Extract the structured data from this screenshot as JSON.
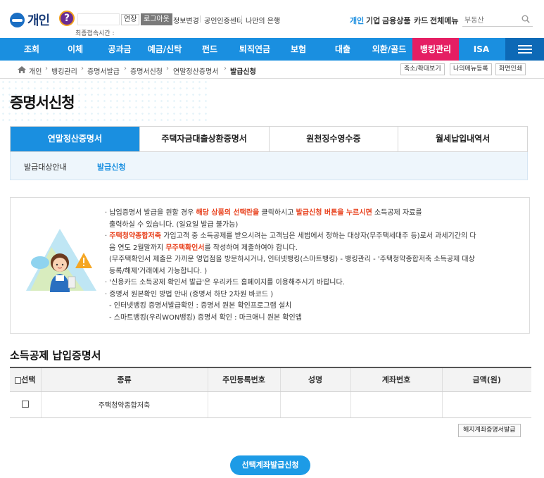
{
  "header": {
    "brand": "개인",
    "help_glyph": "?",
    "extend_label": "연장",
    "logout_label": "로그아웃",
    "top_links": [
      "정보변경",
      "공인인증센터",
      "나만의 은행"
    ],
    "last_login_label": "최종접속시간 :",
    "right_links": [
      {
        "label": "개인",
        "active": true
      },
      {
        "label": "기업",
        "active": false
      },
      {
        "label": "금융상품",
        "active": false
      },
      {
        "label": "카드",
        "active": false
      },
      {
        "label": "전체메뉴",
        "active": false
      }
    ],
    "search": {
      "value": "부동산",
      "icon": "search-icon"
    }
  },
  "nav": {
    "items": [
      {
        "label": "조회",
        "active": false
      },
      {
        "label": "이체",
        "active": false
      },
      {
        "label": "공과금",
        "active": false
      },
      {
        "label": "예금/신탁",
        "active": false
      },
      {
        "label": "펀드",
        "active": false
      },
      {
        "label": "퇴직연금",
        "active": false
      },
      {
        "label": "보험",
        "active": false
      },
      {
        "label": "대출",
        "active": false
      },
      {
        "label": "외환/골드",
        "active": false
      },
      {
        "label": "뱅킹관리",
        "active": true
      },
      {
        "label": "ISA",
        "active": false
      }
    ],
    "menu_icon": "hamburger-icon",
    "active_color": "#e51e63",
    "bar_color": "#1a8fe0"
  },
  "breadcrumb": {
    "home_icon": "home-icon",
    "items": [
      "개인",
      "뱅킹관리",
      "증명서발급",
      "증명서신청",
      "연말정산증명서",
      "발급신청"
    ],
    "tools": [
      "축소/확대보기",
      "나의메뉴등록",
      "화면인쇄"
    ]
  },
  "page": {
    "title": "증명서신청"
  },
  "tabs": [
    {
      "label": "연말정산증명서",
      "active": true
    },
    {
      "label": "주택자금대출상환증명서",
      "active": false
    },
    {
      "label": "원천징수영수증",
      "active": false
    },
    {
      "label": "월세납입내역서",
      "active": false
    }
  ],
  "subtabs": [
    {
      "label": "발급대상안내",
      "active": false
    },
    {
      "label": "발급신청",
      "active": true
    }
  ],
  "notice": {
    "line1": {
      "pre": "납입증명서 발급을 원할 경우 ",
      "hl1": "해당 상품의 선택란을",
      "mid": " 클릭하시고 ",
      "hl2": "발급신청 버튼을 누르시면",
      "post": " 소득공제 자료를"
    },
    "line1b": "출력하실 수 있습니다. (일요일 발급 불가능)",
    "line2": {
      "hl1": "주택청약종합저축",
      "pre": " 가입고객 중 소득공제를 받으시려는 고객님은 세법에서 정하는 대상자(무주택세대주 등)로서 과세기간의 다"
    },
    "line2b": {
      "pre": "음 연도 2월말까지 ",
      "hl": "무주택확인서",
      "post": "를 작성하여 제출하여야 합니다."
    },
    "line2c": "(무주택확인서 제출은 가까운 영업점을 방문하시거나, 인터넷뱅킹(스마트뱅킹) - 뱅킹관리 - '주택청약종합저축 소득공제 대상",
    "line2d": "등록/해제'거래에서 가능합니다. )",
    "line3": "'신용카드 소득공제 확인서 발급'은 우리카드 홈페이지를 이용해주시기 바랍니다.",
    "line4": "증명서 원본확인 방법 안내 (증명서 하단 2차원 바코드 )",
    "line4a": "- 인터넷뱅킹 증명서발급확인 : 증명서 원본 확인프로그램 설치",
    "line4b": "- 스마트뱅킹(우리WON뱅킹) 증명서 확인 : 마크애니 원본 확인앱",
    "highlight_color": "#e8401c"
  },
  "table": {
    "title": "소득공제 납입증명서",
    "headers": [
      "선택",
      "종류",
      "주민등록번호",
      "성명",
      "계좌번호",
      "금액(원)"
    ],
    "rows": [
      {
        "type": "주택청약종합저축",
        "rrn": "",
        "name": "",
        "account": "",
        "amount": ""
      }
    ]
  },
  "buttons": {
    "closed_account": "해지계좌증명서발급",
    "issue": "선택계좌발급신청"
  }
}
